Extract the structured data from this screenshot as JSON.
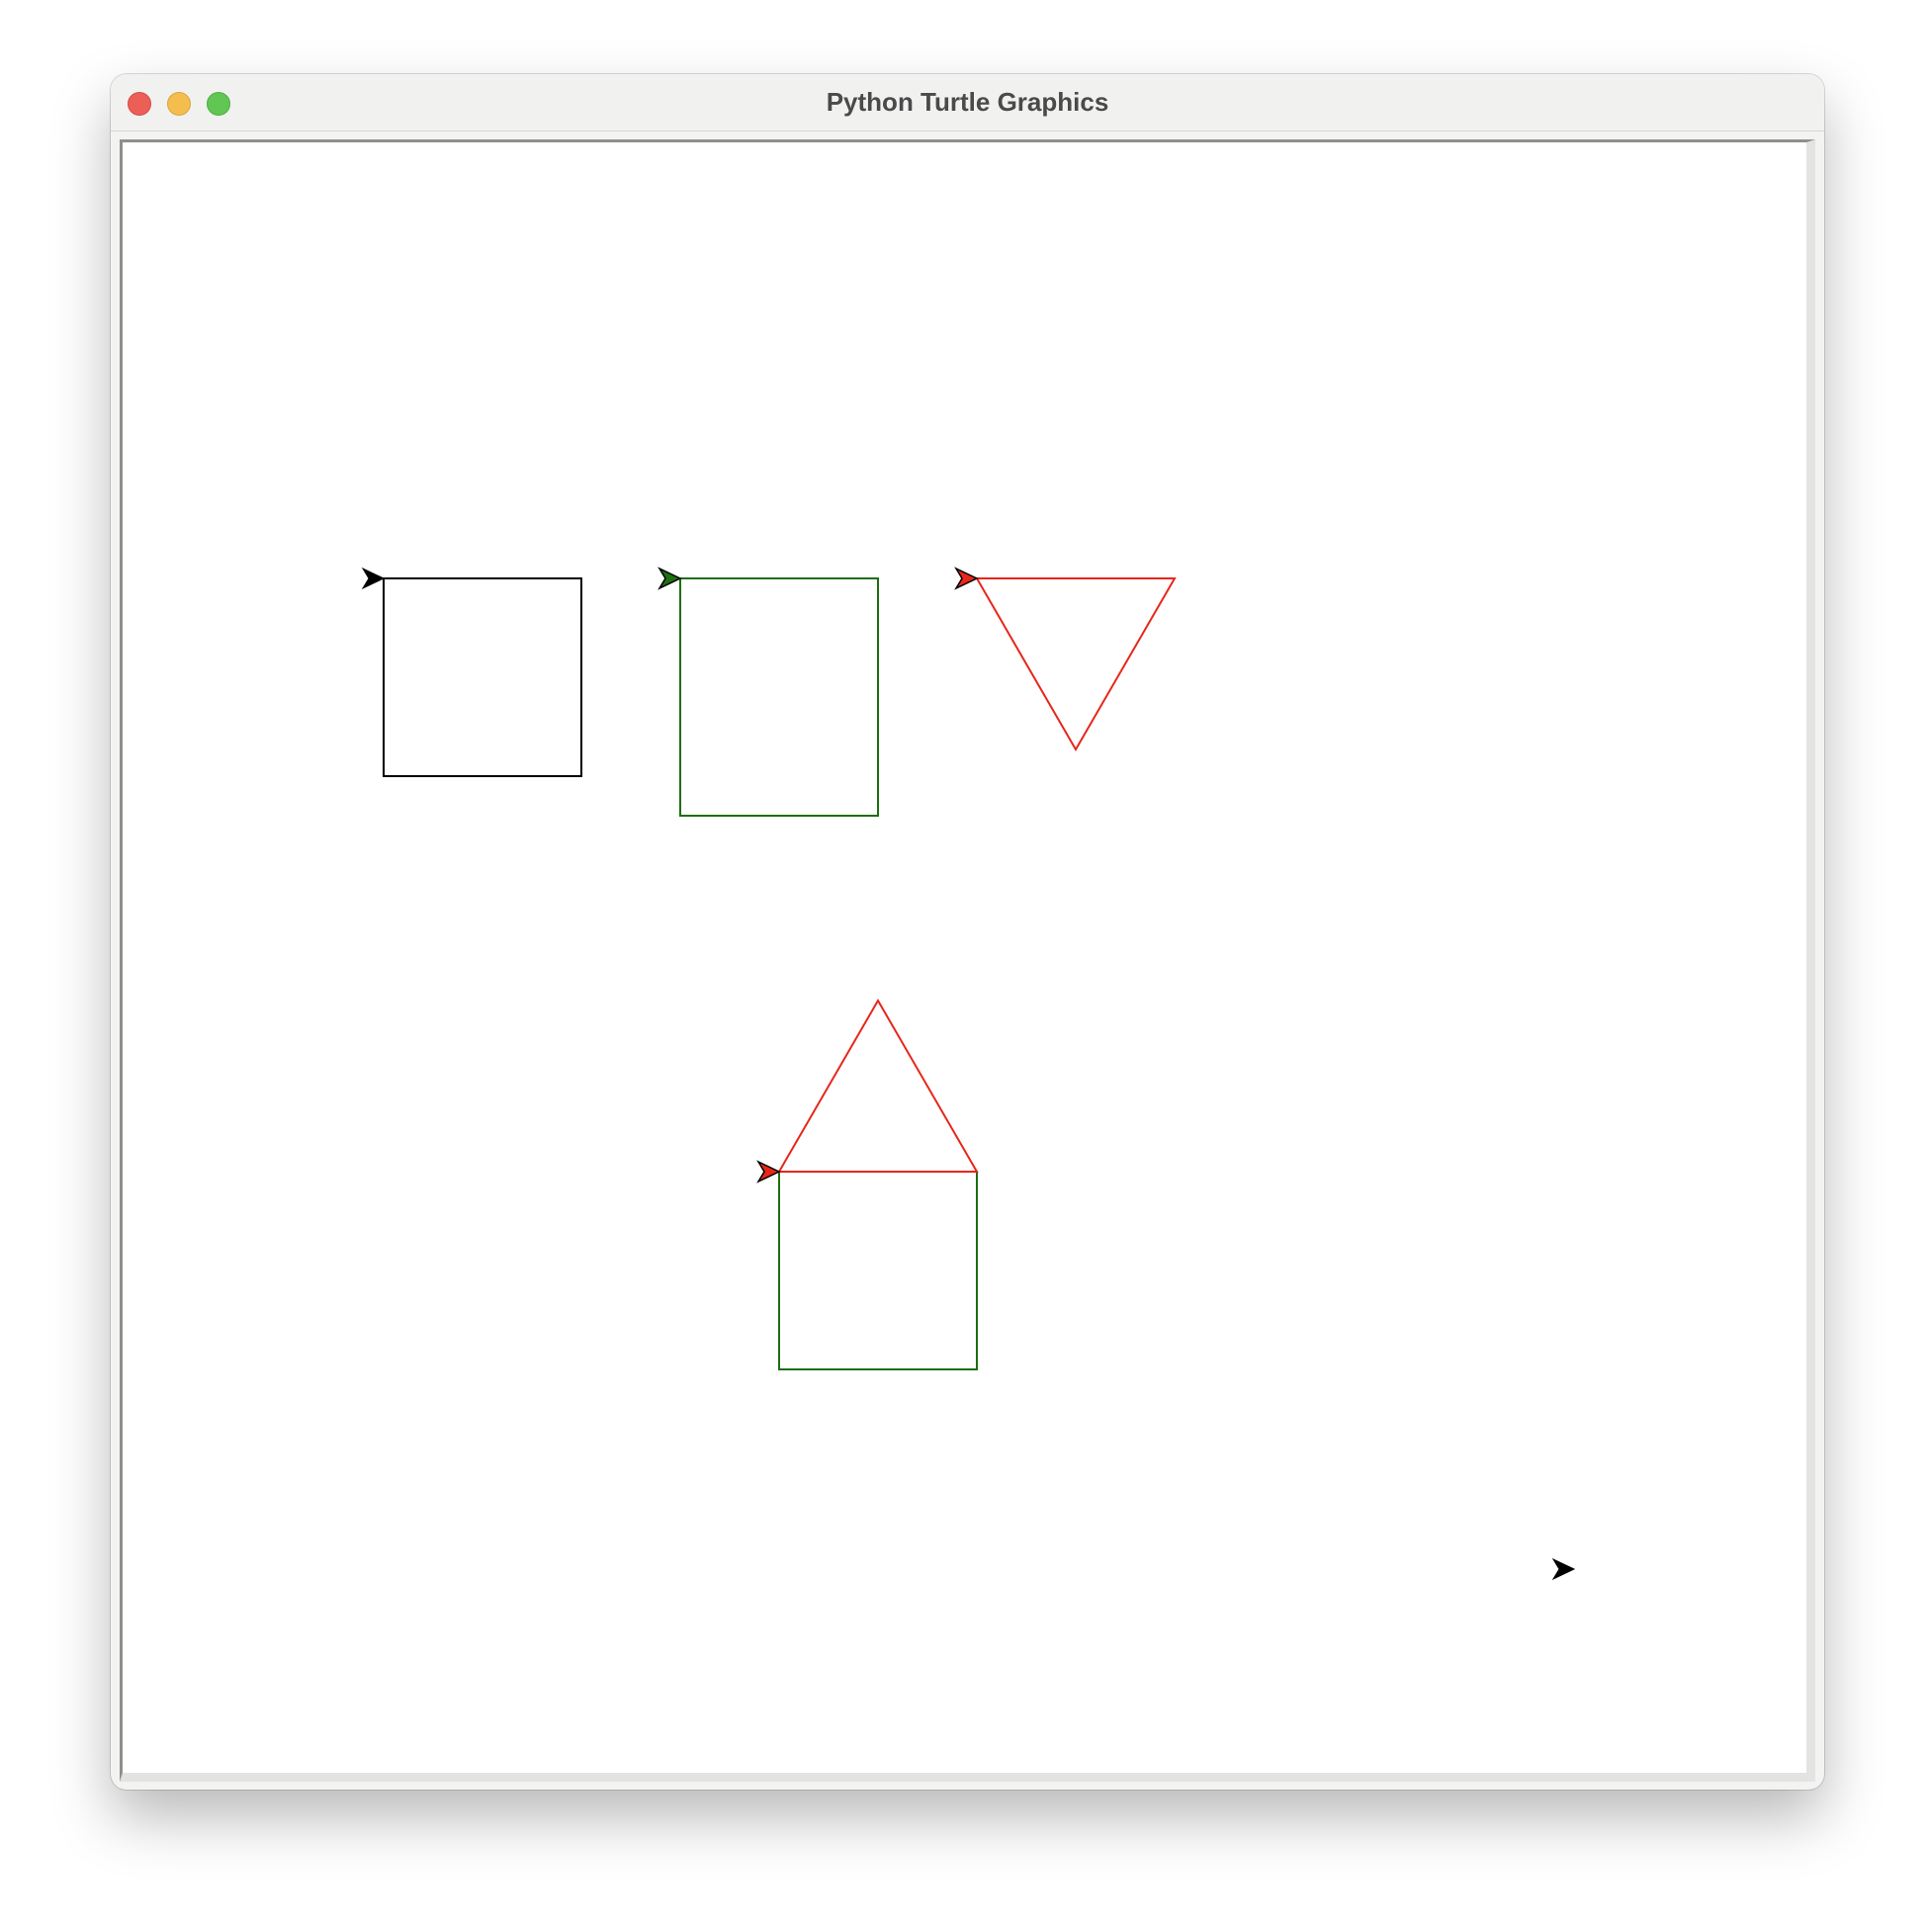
{
  "window": {
    "title": "Python Turtle Graphics"
  },
  "colors": {
    "close": "#ec5f57",
    "minimize": "#f4be4f",
    "maximize": "#62c655",
    "black": "#000000",
    "green": "#1e6e12",
    "red": "#e8261a"
  },
  "icons": {
    "close": "close-button",
    "minimize": "minimize-button",
    "maximize": "maximize-button",
    "turtle": "turtle-arrow-icon"
  }
}
